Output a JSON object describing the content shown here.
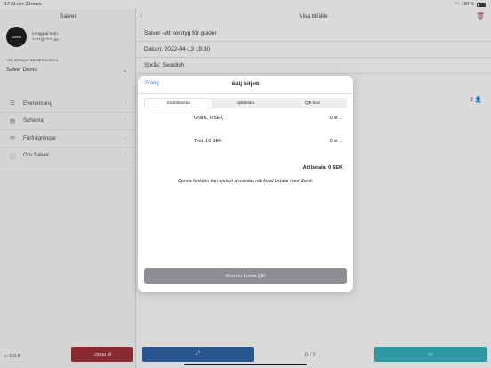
{
  "status_bar": {
    "time_date": "17:33 ons 30 mars",
    "battery": "100 %"
  },
  "sidebar": {
    "title": "Salver",
    "logo_text": "Salver",
    "logged_in_label": "Inloggad som",
    "logged_in_user": "*****@*****.se",
    "admin_note": "Välj arrangör att administrera",
    "organizer": "Salver Demo",
    "items": [
      {
        "label": "Evenemang",
        "icon": "calendar-icon"
      },
      {
        "label": "Schema",
        "icon": "schedule-icon"
      },
      {
        "label": "Förfrågningar",
        "icon": "mail-icon"
      },
      {
        "label": "Om Salver",
        "icon": "info-icon"
      }
    ],
    "version": "v. 0.9.5",
    "logout_label": "Logga ut"
  },
  "main": {
    "title": "Visa tillfälle",
    "info_lines": [
      "Salver -ett verktyg för guider",
      "Datum: 2022-04-13 19:30",
      "Språk: Swedish"
    ],
    "attendee_count": "2",
    "pager": "0 / 2"
  },
  "modal": {
    "close_label": "Stäng",
    "title": "Sälj biljett",
    "tabs": [
      "Snabbkassa",
      "Självboka",
      "QR-kod"
    ],
    "tickets": [
      {
        "name": "Gratis, 0 SEK",
        "qty": "0 st"
      },
      {
        "name": "Test, 10 SEK",
        "qty": "0 st"
      }
    ],
    "total": "Att betala: 0 SEK",
    "notice": "Denna funktion kan endast användas när kund betalar med Swish",
    "scan_label": "Skanna kunds QR"
  },
  "colors": {
    "accent": "#2f78c4",
    "logout": "#8a2b32",
    "primary": "#2a5690",
    "teal": "#2d9aa3"
  }
}
